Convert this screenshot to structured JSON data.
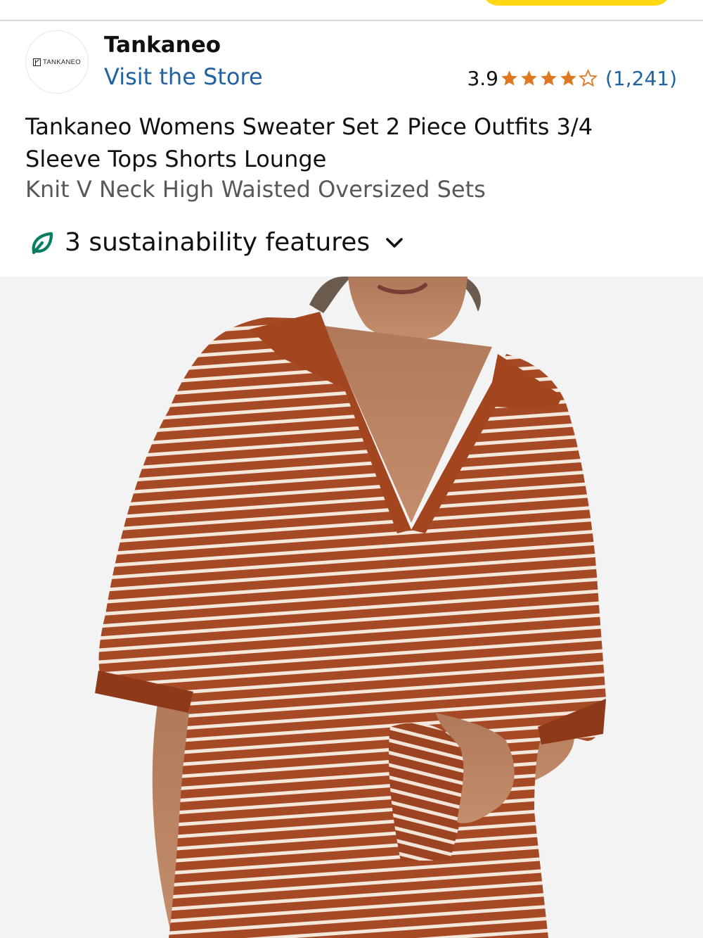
{
  "header": {
    "accent_button_color": "#ffd814"
  },
  "store": {
    "logo_text": "TANKANEO",
    "brand_name": "Tankaneo",
    "visit_label": "Visit the Store",
    "link_color": "#2162a1"
  },
  "rating": {
    "value": "3.9",
    "stars_filled": 4,
    "stars_total": 5,
    "count": "(1,241)",
    "star_color": "#de7921"
  },
  "product": {
    "title": "Tankaneo Womens Sweater Set 2 Piece Outfits 3/4 Sleeve Tops Shorts Lounge",
    "subtitle": "Knit V Neck High Waisted Oversized Sets",
    "image_icon": "product-photo-striped-knit-sweater"
  },
  "sustainability": {
    "label": "3 sustainability features",
    "icon": "leaf-icon",
    "icon_color": "#067d62"
  }
}
